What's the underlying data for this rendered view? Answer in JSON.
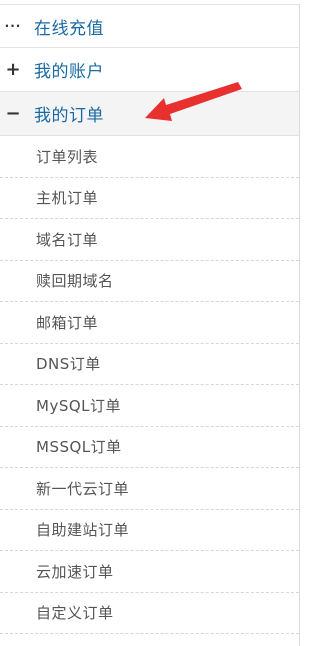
{
  "menu": {
    "top_items": [
      {
        "icon": "more-dots-icon",
        "icon_text": "···",
        "label": "在线充值"
      },
      {
        "icon": "plus-icon",
        "icon_text": "+",
        "label": "我的账户"
      },
      {
        "icon": "minus-icon",
        "icon_text": "−",
        "label": "我的订单"
      }
    ],
    "sub_items": [
      {
        "label": "订单列表"
      },
      {
        "label": "主机订单"
      },
      {
        "label": "域名订单"
      },
      {
        "label": "赎回期域名"
      },
      {
        "label": "邮箱订单"
      },
      {
        "label": "DNS订单"
      },
      {
        "label": "MySQL订单"
      },
      {
        "label": "MSSQL订单"
      },
      {
        "label": "新一代云订单"
      },
      {
        "label": "自助建站订单"
      },
      {
        "label": "云加速订单"
      },
      {
        "label": "自定义订单"
      }
    ]
  },
  "colors": {
    "link_blue": "#1a6aa4",
    "arrow_red": "#e8312f",
    "sub_text": "#555555",
    "active_bg": "#f4f4f4"
  }
}
